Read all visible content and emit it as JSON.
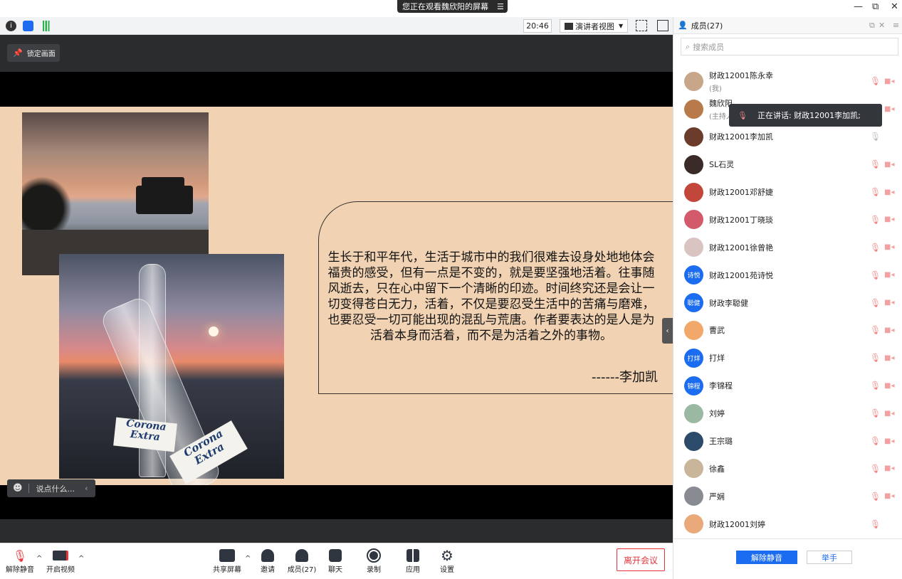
{
  "titlebar": {
    "share_text": "您正在观看魏欣阳的屏幕",
    "minimize": "—",
    "restore": "⧉",
    "close": "✕"
  },
  "toolbar": {
    "time": "20:46",
    "view_label": "演讲者视图"
  },
  "stage": {
    "lock_label": "锁定画面",
    "quote": "生长于和平年代，生活于城市中的我们很难去设身处地地体会福贵的感受，但有一点是不变的，就是要坚强地活着。往事随风逝去，只在心中留下一个清晰的印迹。时间终究还是会让一切变得苍白无力，活着，不仅是要忍受生活中的苦痛与磨难，也要忍受一切可能出现的混乱与荒唐。作者要表达的是人是为活着本身而活着，而不是为活着之外的事物。",
    "quote_author": "------李加凯",
    "label1": "Corona Extra",
    "label2": "Corona Extra",
    "chat_placeholder": "说点什么..."
  },
  "bottombar": {
    "unmute": "解除静音",
    "start_video": "开启视频",
    "share_screen": "共享屏幕",
    "invite": "邀请",
    "members": "成员(27)",
    "chat": "聊天",
    "record": "录制",
    "apps": "应用",
    "settings": "设置",
    "leave": "离开会议"
  },
  "panel": {
    "title": "成员(27)",
    "search_placeholder": "搜索成员",
    "tooltip": "正在讲话: 财政12001李加凯;",
    "members": [
      {
        "name": "财政12001陈永幸",
        "sub": "(我)",
        "avatar": "#c8a68a"
      },
      {
        "name": "魏欣阳",
        "sub": "(主持人)",
        "avatar": "#b87a4a"
      },
      {
        "name": "财政12001李加凯",
        "sub": "",
        "avatar": "#6b3c2c"
      },
      {
        "name": "SL石灵",
        "sub": "",
        "avatar": "#3a2a28"
      },
      {
        "name": "财政12001邓舒婕",
        "sub": "",
        "avatar": "#c2463a"
      },
      {
        "name": "财政12001丁晓琰",
        "sub": "",
        "avatar": "#d25a6a"
      },
      {
        "name": "财政12001徐曾艳",
        "sub": "",
        "avatar": "#d9c4c2"
      },
      {
        "name": "财政12001苑诗悦",
        "sub": "",
        "avatar_text": "诗悦"
      },
      {
        "name": "财政李聪健",
        "sub": "",
        "avatar_text": "聪健"
      },
      {
        "name": "曹武",
        "sub": "",
        "avatar": "#f2a86a"
      },
      {
        "name": "打烊",
        "sub": "",
        "avatar_text": "打烊"
      },
      {
        "name": "李锦程",
        "sub": "",
        "avatar_text": "锦程"
      },
      {
        "name": "刘婷",
        "sub": "",
        "avatar": "#9ab8a2"
      },
      {
        "name": "王宗璐",
        "sub": "",
        "avatar": "#2c4a6a"
      },
      {
        "name": "徐鑫",
        "sub": "",
        "avatar": "#c9b59a"
      },
      {
        "name": "严娴",
        "sub": "",
        "avatar": "#888c92"
      },
      {
        "name": "财政12001刘婷",
        "sub": "",
        "avatar": "#e9a97a"
      }
    ],
    "unmute_all": "解除静音",
    "raise_hand": "举手"
  }
}
